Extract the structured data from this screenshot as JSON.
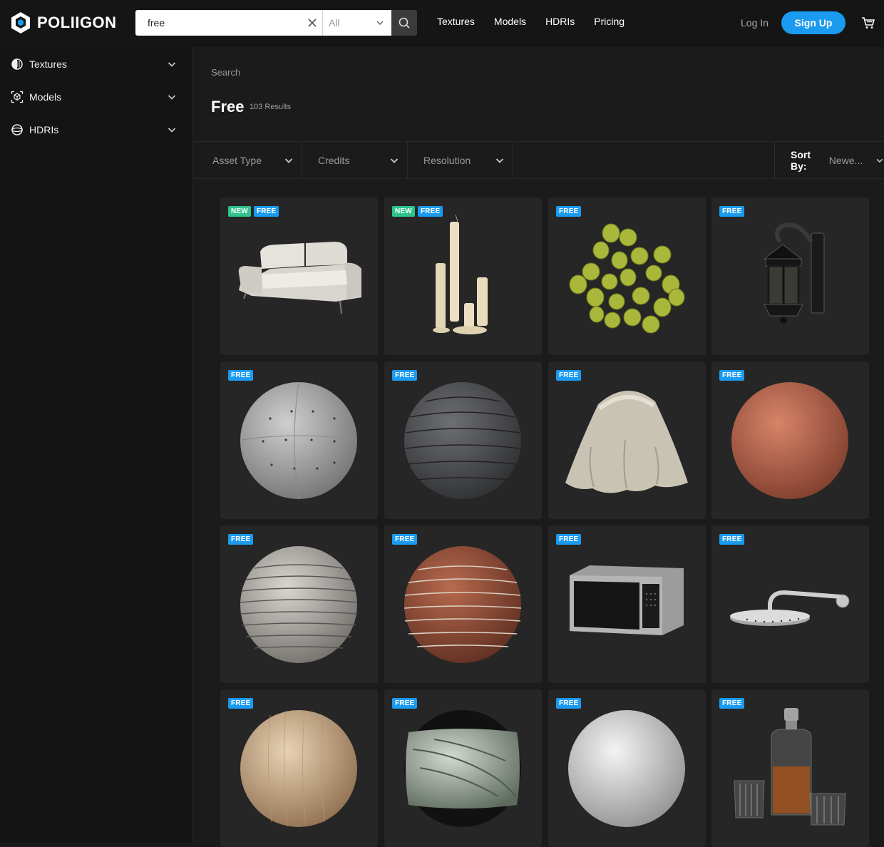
{
  "brand": {
    "name": "POLIIGON"
  },
  "search": {
    "value": "free",
    "type_selected": "All"
  },
  "topnav": [
    "Textures",
    "Models",
    "HDRIs",
    "Pricing"
  ],
  "auth": {
    "login": "Log In",
    "signup": "Sign Up"
  },
  "colors": {
    "accent": "#1a9bf0",
    "new_badge": "#2ec48c",
    "free_badge": "#1b9bf0",
    "card_bg": "#262626"
  },
  "sidebar": {
    "items": [
      {
        "label": "Textures",
        "icon": "textures-icon"
      },
      {
        "label": "Models",
        "icon": "models-icon"
      },
      {
        "label": "HDRIs",
        "icon": "hdris-icon"
      }
    ]
  },
  "main": {
    "breadcrumb": "Search",
    "title": "Free",
    "result_count": "103 Results"
  },
  "filters": {
    "items": [
      "Asset Type",
      "Credits",
      "Resolution"
    ],
    "sort_label": "Sort By:",
    "sort_value": "Newe..."
  },
  "assets": [
    {
      "name": "sofa",
      "badges": [
        "NEW",
        "FREE"
      ]
    },
    {
      "name": "candles",
      "badges": [
        "NEW",
        "FREE"
      ]
    },
    {
      "name": "grapes",
      "badges": [
        "FREE"
      ]
    },
    {
      "name": "lantern",
      "badges": [
        "FREE"
      ]
    },
    {
      "name": "concrete-sphere",
      "badges": [
        "FREE"
      ]
    },
    {
      "name": "roof-shingles-sphere",
      "badges": [
        "FREE"
      ]
    },
    {
      "name": "draped-fabric",
      "badges": [
        "FREE"
      ]
    },
    {
      "name": "terracotta-sphere",
      "badges": [
        "FREE"
      ]
    },
    {
      "name": "wood-planks-sphere",
      "badges": [
        "FREE"
      ]
    },
    {
      "name": "brick-sphere",
      "badges": [
        "FREE"
      ]
    },
    {
      "name": "microwave",
      "badges": [
        "FREE"
      ]
    },
    {
      "name": "shower-head",
      "badges": [
        "FREE"
      ]
    },
    {
      "name": "wood-veneer-sphere",
      "badges": [
        "FREE"
      ]
    },
    {
      "name": "marble-sphere",
      "badges": [
        "FREE"
      ]
    },
    {
      "name": "white-plaster-sphere",
      "badges": [
        "FREE"
      ]
    },
    {
      "name": "decanter-glasses",
      "badges": [
        "FREE"
      ]
    }
  ]
}
